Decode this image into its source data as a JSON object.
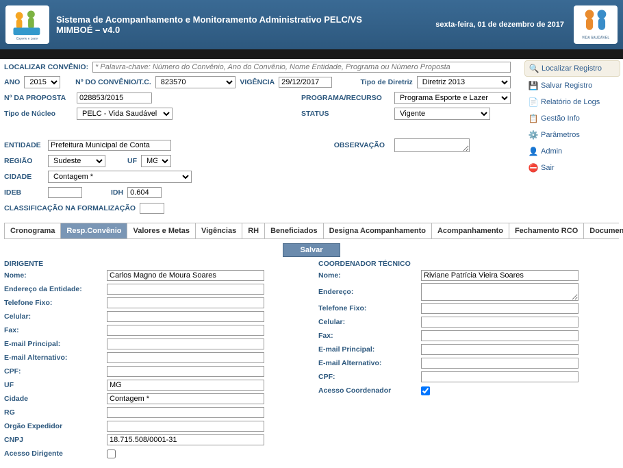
{
  "header": {
    "title_line1": "Sistema de Acompanhamento e Monitoramento Administrativo PELC/VS",
    "title_line2": "MIMBOÉ – v4.0",
    "date": "sexta-feira, 01 de dezembro de 2017",
    "logo_left_caption": "Esporte e Lazer",
    "logo_right_caption": "VIDA SAUDÁVEL"
  },
  "search": {
    "label": "LOCALIZAR CONVÊNIO:",
    "placeholder": "* Palavra-chave: Número do Convênio, Ano do Convênio, Nome Entidade, Programa ou Número Proposta"
  },
  "filters": {
    "ano_label": "ANO",
    "ano_value": "2015",
    "conv_label": "Nº DO CONVÊNIO/T.C.",
    "conv_value": "823570",
    "vig_label": "VIGÊNCIA",
    "vig_value": "29/12/2017",
    "diretriz_label": "Tipo de Diretriz",
    "diretriz_value": "Diretriz 2013",
    "proposta_label": "Nº DA PROPOSTA",
    "proposta_value": "028853/2015",
    "programa_label": "PROGRAMA/RECURSO",
    "programa_value": "Programa Esporte e Lazer",
    "nucleo_label": "Tipo de Núcleo",
    "nucleo_value": "PELC - Vida Saudável",
    "status_label": "STATUS",
    "status_value": "Vigente",
    "entidade_label": "ENTIDADE",
    "entidade_value": "Prefeitura Municipal de Conta",
    "obs_label": "OBSERVAÇÃO",
    "obs_value": "",
    "regiao_label": "REGIÃO",
    "regiao_value": "Sudeste",
    "uf_label": "UF",
    "uf_value": "MG",
    "cidade_label": "CIDADE",
    "cidade_value": "Contagem *",
    "ideb_label": "IDEB",
    "ideb_value": "",
    "idh_label": "IDH",
    "idh_value": "0.604",
    "classif_label": "CLASSIFICAÇÃO NA FORMALIZAÇÃO",
    "classif_value": ""
  },
  "sidemenu": {
    "localizar": "Localizar Registro",
    "salvar": "Salvar Registro",
    "relatorio": "Relatório de Logs",
    "gestao": "Gestão Info",
    "parametros": "Parâmetros",
    "admin": "Admin",
    "sair": "Sair"
  },
  "tabs": {
    "cronograma": "Cronograma",
    "resp": "Resp.Convênio",
    "valores": "Valores e Metas",
    "vigencias": "Vigências",
    "rh": "RH",
    "beneficiados": "Beneficiados",
    "designa": "Designa Acompanhamento",
    "acomp": "Acompanhamento",
    "fechamento": "Fechamento RCO",
    "documentos": "Documentos"
  },
  "salvar_btn": "Salvar",
  "dirigente": {
    "section": "DIRIGENTE",
    "nome_label": "Nome:",
    "nome_value": "Carlos Magno de Moura Soares",
    "endereco_label": "Endereço da Entidade:",
    "endereco_value": "",
    "telfixo_label": "Telefone Fixo:",
    "telfixo_value": "",
    "celular_label": "Celular:",
    "celular_value": "",
    "fax_label": "Fax:",
    "fax_value": "",
    "email1_label": "E-mail Principal:",
    "email1_value": "",
    "email2_label": "E-mail Alternativo:",
    "email2_value": "",
    "cpf_label": "CPF:",
    "cpf_value": "",
    "uf_label": "UF",
    "uf_value": "MG",
    "cidade_label": "Cidade",
    "cidade_value": "Contagem *",
    "rg_label": "RG",
    "rg_value": "",
    "orgao_label": "Orgão Expedidor",
    "orgao_value": "",
    "cnpj_label": "CNPJ",
    "cnpj_value": "18.715.508/0001-31",
    "acesso_label": "Acesso Dirigente"
  },
  "coordenador": {
    "section": "COORDENADOR TÉCNICO",
    "nome_label": "Nome:",
    "nome_value": "Riviane Patrícia Vieira Soares",
    "endereco_label": "Endereço:",
    "endereco_value": "",
    "telfixo_label": "Telefone Fixo:",
    "telfixo_value": "",
    "celular_label": "Celular:",
    "celular_value": "",
    "fax_label": "Fax:",
    "fax_value": "",
    "email1_label": "E-mail Principal:",
    "email1_value": "",
    "email2_label": "E-mail Alternativo:",
    "email2_value": "",
    "cpf_label": "CPF:",
    "cpf_value": "",
    "acesso_label": "Acesso Coordenador"
  }
}
